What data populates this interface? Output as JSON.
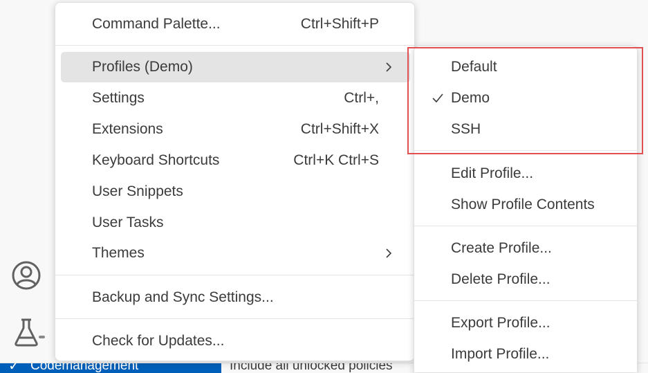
{
  "main_menu": {
    "items": [
      {
        "label": "Command Palette...",
        "shortcut": "Ctrl+Shift+P"
      },
      {
        "label": "Profiles (Demo)",
        "shortcut": "",
        "submenu": true,
        "active": true
      },
      {
        "label": "Settings",
        "shortcut": "Ctrl+,"
      },
      {
        "label": "Extensions",
        "shortcut": "Ctrl+Shift+X"
      },
      {
        "label": "Keyboard Shortcuts",
        "shortcut": "Ctrl+K Ctrl+S"
      },
      {
        "label": "User Snippets",
        "shortcut": ""
      },
      {
        "label": "User Tasks",
        "shortcut": ""
      },
      {
        "label": "Themes",
        "shortcut": "",
        "submenu": true
      },
      {
        "label": "Backup and Sync Settings...",
        "shortcut": ""
      },
      {
        "label": "Check for Updates...",
        "shortcut": ""
      }
    ]
  },
  "profiles_submenu": {
    "items": [
      {
        "label": "Default",
        "checked": false
      },
      {
        "label": "Demo",
        "checked": true
      },
      {
        "label": "SSH",
        "checked": false
      },
      {
        "label": "Edit Profile..."
      },
      {
        "label": "Show Profile Contents"
      },
      {
        "label": "Create Profile..."
      },
      {
        "label": "Delete Profile..."
      },
      {
        "label": "Export Profile..."
      },
      {
        "label": "Import Profile..."
      }
    ]
  },
  "activity_bar": {
    "icons": [
      "accounts-icon",
      "testing-flask-icon"
    ]
  },
  "status_bar": {
    "left_icon": "check-icon",
    "left_text": "Codemanagement",
    "right_text": "Include all unlocked policies"
  },
  "colors": {
    "status_bar_accent": "#005fb8",
    "menu_active_background": "#e4e4e4",
    "highlight_border": "#e05050"
  }
}
